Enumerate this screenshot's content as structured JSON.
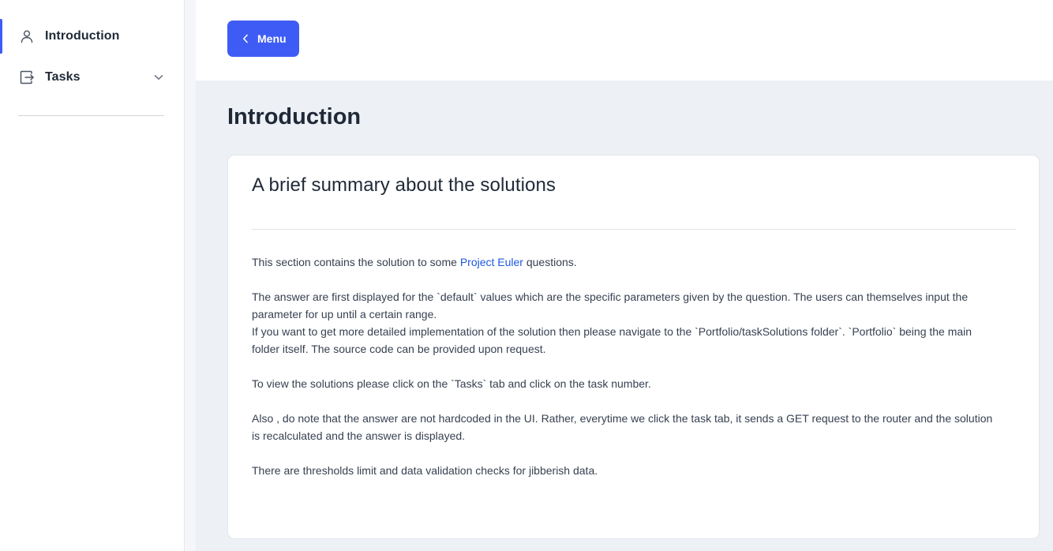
{
  "colors": {
    "accent": "#3e5cf5",
    "link": "#1d58e0",
    "main_background": "#edf0f5"
  },
  "sidebar": {
    "items": [
      {
        "label": "Introduction",
        "icon": "user-icon",
        "active": true
      },
      {
        "label": "Tasks",
        "icon": "exit-box-icon",
        "expandable": true,
        "expand_icon": "chevron-down-icon"
      }
    ]
  },
  "topbar": {
    "menu_button": {
      "label": "Menu",
      "icon": "chevron-left-icon"
    }
  },
  "main": {
    "page_title": "Introduction",
    "card": {
      "title": "A brief summary about the solutions",
      "intro_before_link": "This section contains the solution to some ",
      "intro_link": "Project Euler",
      "intro_after_link": " questions.",
      "paragraph_defaults": "The answer are first displayed for the `default` values which are the specific parameters given by the question. The users can themselves input the parameter for up until a certain range.",
      "paragraph_implementation": "If you want to get more detailed implementation of the solution then please navigate to the `Portfolio/taskSolutions folder`. `Portfolio` being the main folder itself. The source code can be provided upon request.",
      "paragraph_tasks": "To view the solutions please click on the `Tasks` tab and click on the task number.",
      "paragraph_hardcoded": "Also , do note that the answer are not hardcoded in the UI. Rather, everytime we click the task tab, it sends a GET request to the router and the solution is recalculated and the answer is displayed.",
      "paragraph_thresholds": "There are thresholds limit and data validation checks for jibberish data."
    }
  }
}
